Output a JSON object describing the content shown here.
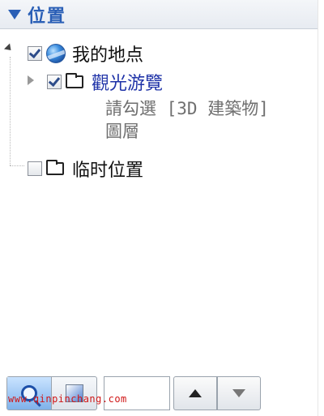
{
  "panel": {
    "title": "位置"
  },
  "tree": {
    "root": {
      "label": "我的地点",
      "checked": true,
      "icon": "globe-icon"
    },
    "child1": {
      "label": "觀光游覽",
      "checked": true,
      "icon": "folder-icon",
      "note_line1": "請勾選 [3D 建築物]",
      "note_line2": "圖層"
    },
    "child2": {
      "label": "临时位置",
      "checked": false,
      "icon": "folder-icon"
    }
  },
  "toolbar": {
    "search_value": "",
    "buttons": [
      "search-icon",
      "layer-panel-icon",
      "arrow-up-icon",
      "arrow-down-icon"
    ]
  },
  "watermark": "www.qinpinchang.com",
  "colors": {
    "header_text": "#2a5fb6",
    "link": "#1f33a8",
    "watermark": "#d01616"
  }
}
